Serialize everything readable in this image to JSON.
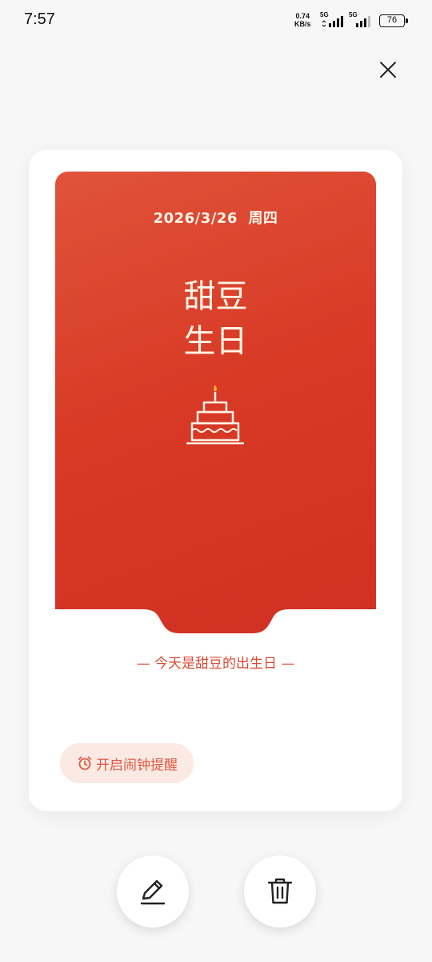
{
  "status_bar": {
    "time": "7:57",
    "net_speed_value": "0.74",
    "net_speed_unit": "KB/s",
    "sim1_label": "5G",
    "sim2_label": "5G",
    "battery": "76"
  },
  "card": {
    "date": "2026/3/26",
    "weekday": "周四",
    "title_line1": "甜豆",
    "title_line2": "生日",
    "subtitle": "— 今天是甜豆的出生日 —",
    "alarm_button_label": "开启闹钟提醒"
  },
  "icons": {
    "close": "close-icon",
    "cake": "cake-icon",
    "alarm": "alarm-clock-icon",
    "edit": "pencil-icon",
    "delete": "trash-icon"
  },
  "colors": {
    "card_red": "#d83a26",
    "accent_text": "#d94a32",
    "alarm_button_bg": "#fbe9e4",
    "title_text": "#fff4e6"
  }
}
